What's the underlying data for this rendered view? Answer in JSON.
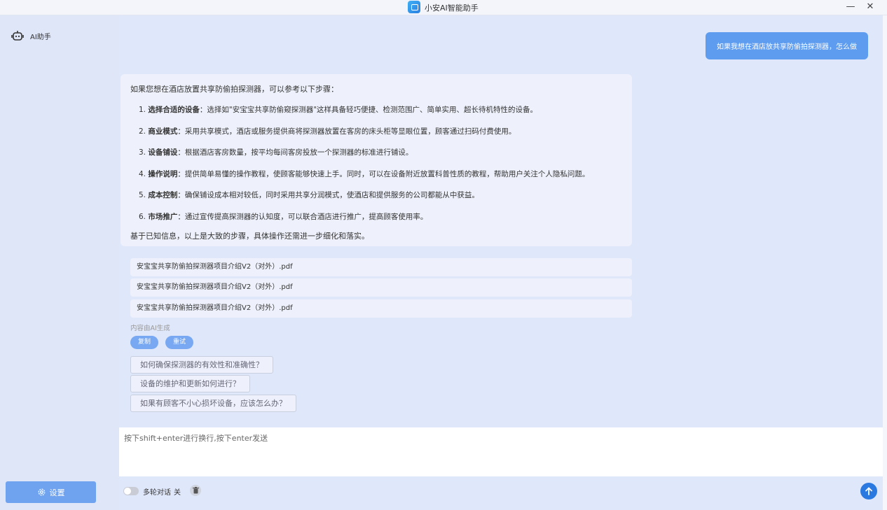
{
  "window": {
    "title": "小安AI智能助手",
    "minimize": "—",
    "close": "✕"
  },
  "sidebar": {
    "assistant_label": "AI助手",
    "settings_label": "设置"
  },
  "chat": {
    "user_message": "如果我想在酒店放共享防偷拍探测器，怎么做",
    "answer": {
      "intro": "如果您想在酒店放置共享防偷拍探测器，可以参考以下步骤：",
      "steps": [
        {
          "num": "1.",
          "title": "选择合适的设备",
          "text": "：选择如\"安宝宝共享防偷窥探测器\"这样具备轻巧便捷、检测范围广、简单实用、超长待机特性的设备。"
        },
        {
          "num": "2.",
          "title": "商业模式",
          "text": "：采用共享模式，酒店或服务提供商将探测器放置在客房的床头柜等显眼位置，顾客通过扫码付费使用。"
        },
        {
          "num": "3.",
          "title": "设备铺设",
          "text": "：根据酒店客房数量，按平均每间客房投放一个探测器的标准进行铺设。"
        },
        {
          "num": "4.",
          "title": "操作说明",
          "text": "：提供简单易懂的操作教程，使顾客能够快速上手。同时，可以在设备附近放置科普性质的教程，帮助用户关注个人隐私问题。"
        },
        {
          "num": "5.",
          "title": "成本控制",
          "text": "：确保铺设成本相对较低，同时采用共享分润模式，使酒店和提供服务的公司都能从中获益。"
        },
        {
          "num": "6.",
          "title": "市场推广",
          "text": "：通过宣传提高探测器的认知度，可以联合酒店进行推广，提高顾客使用率。"
        }
      ],
      "outro": "基于已知信息，以上是大致的步骤，具体操作还需进一步细化和落实。"
    },
    "sources": [
      "安宝宝共享防偷拍探测器项目介绍V2（对外）.pdf",
      "安宝宝共享防偷拍探测器项目介绍V2（对外）.pdf",
      "安宝宝共享防偷拍探测器项目介绍V2（对外）.pdf"
    ],
    "ai_note": "内容由AI生成",
    "copy_label": "复制",
    "retry_label": "重试",
    "suggestions": [
      "如何确保探测器的有效性和准确性？",
      "设备的维护和更新如何进行？",
      "如果有顾客不小心损坏设备，应该怎么办？"
    ]
  },
  "input": {
    "placeholder": "按下shift+enter进行换行,按下enter发送"
  },
  "footer": {
    "multi_turn_label": "多轮对话",
    "multi_turn_state": "关"
  },
  "colors": {
    "accent": "#2a79e0",
    "bubble": "#5e9cf0",
    "pill": "#77a8f1",
    "settings": "#6fa3ef"
  }
}
